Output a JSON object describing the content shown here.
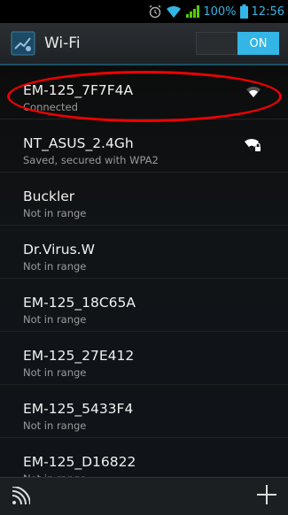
{
  "status": {
    "battery": "100%",
    "time": "12:56"
  },
  "header": {
    "title": "Wi-Fi",
    "toggle_label": "ON"
  },
  "networks": [
    {
      "name": "EM-125_7F7F4A",
      "status": "Connected",
      "icon": "wifi-signal-icon"
    },
    {
      "name": "NT_ASUS_2.4Gh",
      "status": "Saved, secured with WPA2",
      "icon": "wifi-locked-icon"
    },
    {
      "name": "Buckler",
      "status": "Not in range"
    },
    {
      "name": "Dr.Virus.W",
      "status": "Not in range"
    },
    {
      "name": "EM-125_18C65A",
      "status": "Not in range"
    },
    {
      "name": "EM-125_27E412",
      "status": "Not in range"
    },
    {
      "name": "EM-125_5433F4",
      "status": "Not in range"
    },
    {
      "name": "EM-125_D16822",
      "status": "Not in range"
    }
  ],
  "bottom": {
    "left_icon": "wps-icon",
    "right_icon": "add-icon"
  },
  "colors": {
    "accent": "#33b5e5",
    "highlight": "#e00000"
  }
}
